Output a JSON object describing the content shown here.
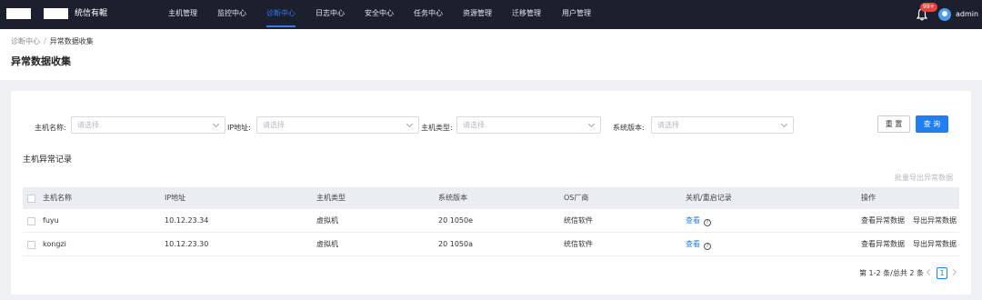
{
  "nav": {
    "brand": "统信有輥",
    "items": [
      "主机管理",
      "监控中心",
      "诊断中心",
      "日志中心",
      "安全中心",
      "任务中心",
      "资源管理",
      "迁移管理",
      "用户管理"
    ],
    "active_index": 2,
    "notification_badge": "99+",
    "username": "admin"
  },
  "breadcrumb": {
    "parent": "诊断中心",
    "separator": "/",
    "current": "异常数据收集"
  },
  "page_title": "异常数据收集",
  "filters": {
    "host_name": {
      "label": "主机名称:",
      "placeholder": "请选择"
    },
    "ip": {
      "label": "IP地址:",
      "placeholder": "请选择"
    },
    "host_type": {
      "label": "主机类型:",
      "placeholder": "请选择"
    },
    "os_version": {
      "label": "系统版本:",
      "placeholder": "请选择"
    },
    "reset_label": "重 置",
    "query_label": "查 询"
  },
  "section_title": "主机异常记录",
  "bulk_export_label": "批量导出异常数据",
  "table": {
    "columns": [
      "主机名称",
      "IP地址",
      "主机类型",
      "系统版本",
      "OS厂商",
      "关机/重启记录",
      "操作"
    ],
    "rows": [
      {
        "host": "fuyu",
        "ip": "10.12.23.34",
        "type": "虚拟机",
        "version": "20 1050e",
        "vendor": "统信软件",
        "record_link": "查看",
        "action_view": "查看异常数据",
        "action_export": "导出异常数据"
      },
      {
        "host": "kongzi",
        "ip": "10.12.23.30",
        "type": "虚拟机",
        "version": "20 1050a",
        "vendor": "统信软件",
        "record_link": "查看",
        "action_view": "查看异常数据",
        "action_export": "导出异常数据"
      }
    ]
  },
  "pagination": {
    "summary": "第 1-2 条/总共 2 条",
    "current_page": "1"
  },
  "colors": {
    "nav_bg": "#1b1f2e",
    "accent": "#1f7ef0",
    "badge": "#f04040"
  }
}
